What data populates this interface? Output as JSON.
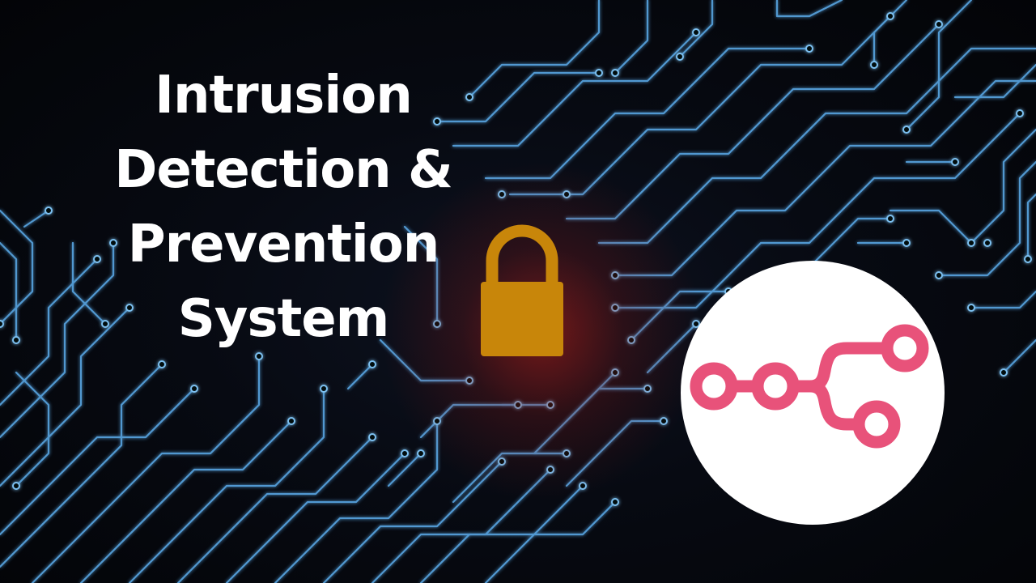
{
  "title": {
    "lines": [
      "Intrusion",
      "Detection &",
      "Prevention",
      "System"
    ],
    "color": "#ffffff"
  },
  "lock": {
    "icon": "padlock-icon",
    "color": "#c8860a",
    "glow": "#d0281c"
  },
  "logo": {
    "icon": "workflow-nodes-icon",
    "color": "#e8527a",
    "background": "#ffffff"
  },
  "circuit": {
    "icon": "circuit-board-traces",
    "color": "#5aa8e6"
  }
}
